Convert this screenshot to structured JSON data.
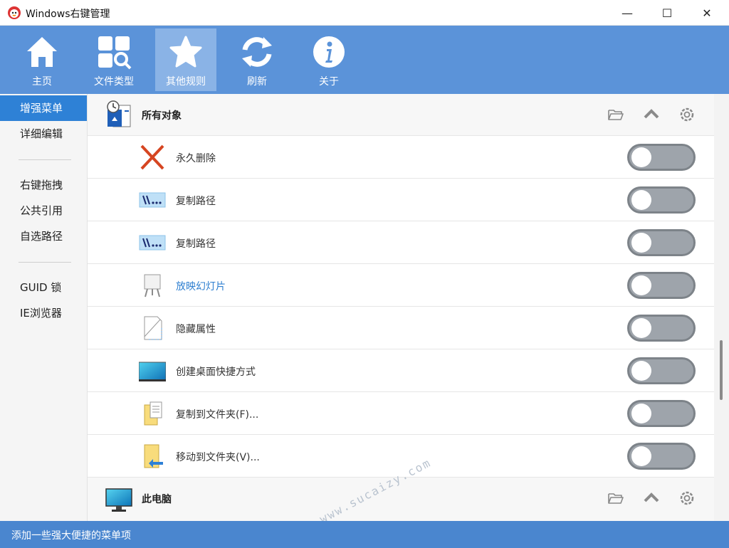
{
  "window": {
    "title": "Windows右键管理",
    "minimize_glyph": "—",
    "maximize_glyph": "☐",
    "close_glyph": "✕"
  },
  "toolbar": {
    "items": [
      {
        "label": "主页",
        "icon": "home-icon",
        "active": false
      },
      {
        "label": "文件类型",
        "icon": "file-types-icon",
        "active": false
      },
      {
        "label": "其他规则",
        "icon": "star-icon",
        "active": true
      },
      {
        "label": "刷新",
        "icon": "refresh-icon",
        "active": false
      },
      {
        "label": "关于",
        "icon": "info-icon",
        "active": false
      }
    ]
  },
  "sidebar": {
    "items": [
      {
        "label": "增强菜单",
        "active": true
      },
      {
        "label": "详细编辑",
        "active": false
      },
      {
        "label": "右键拖拽",
        "active": false
      },
      {
        "label": "公共引用",
        "active": false
      },
      {
        "label": "自选路径",
        "active": false
      },
      {
        "label": "GUID 锁",
        "active": false
      },
      {
        "label": "IE浏览器",
        "active": false
      }
    ]
  },
  "groups": [
    {
      "title": "所有对象",
      "icon": "all-objects-icon"
    },
    {
      "title": "此电脑",
      "icon": "computer-icon"
    }
  ],
  "items": [
    {
      "label": "永久删除",
      "icon": "delete-x-icon",
      "enabled": false
    },
    {
      "label": "复制路径",
      "icon": "path-icon",
      "enabled": false
    },
    {
      "label": "复制路径",
      "icon": "path-icon",
      "enabled": false
    },
    {
      "label": "放映幻灯片",
      "icon": "slideshow-icon",
      "enabled": false
    },
    {
      "label": "隐藏属性",
      "icon": "hidden-file-icon",
      "enabled": false
    },
    {
      "label": "创建桌面快捷方式",
      "icon": "desktop-shortcut-icon",
      "enabled": false
    },
    {
      "label": "复制到文件夹(F)...",
      "icon": "copy-to-folder-icon",
      "enabled": false
    },
    {
      "label": "移动到文件夹(V)...",
      "icon": "move-to-folder-icon",
      "enabled": false
    }
  ],
  "status": {
    "text": "添加一些强大便捷的菜单项"
  },
  "watermark": "www.sucaizy.com",
  "colors": {
    "accent": "#5b93d9",
    "sidebar_active": "#2e81d6",
    "status": "#4a86cf",
    "link": "#2e7fd0"
  }
}
